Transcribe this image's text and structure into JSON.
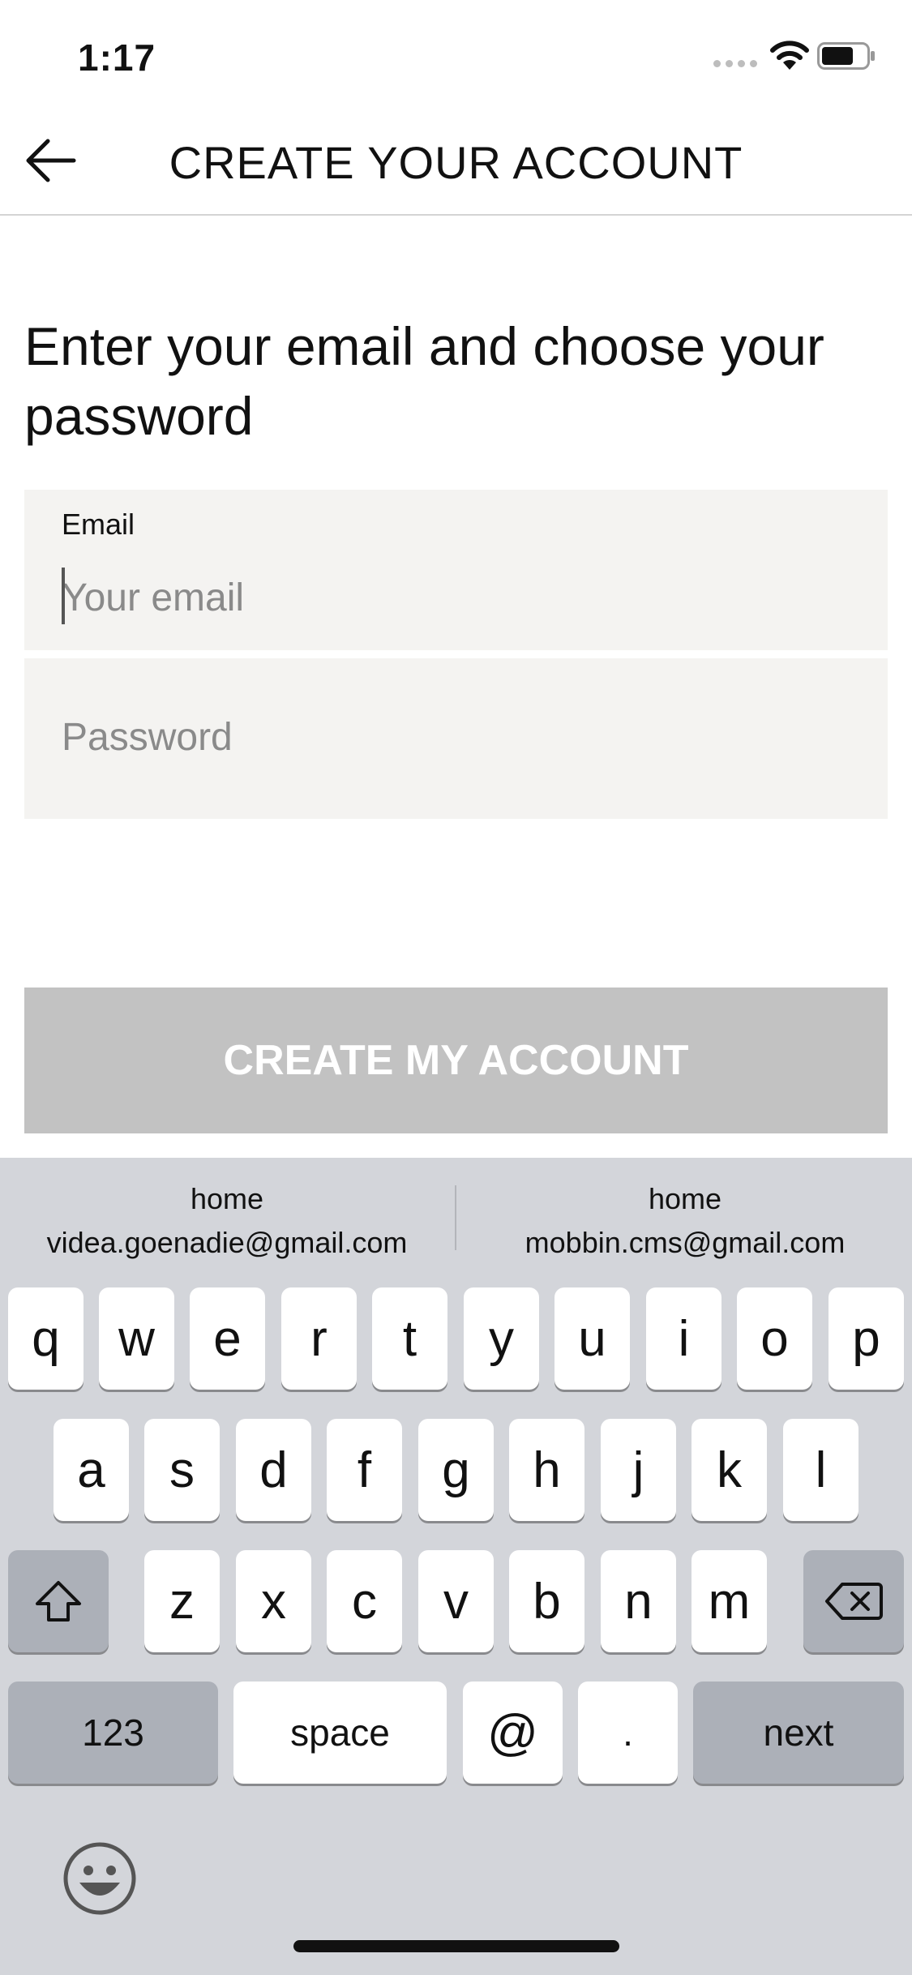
{
  "status_bar": {
    "time": "1:17"
  },
  "header": {
    "title": "CREATE YOUR ACCOUNT",
    "back_icon": "arrow-left-icon"
  },
  "main": {
    "heading": "Enter your email and choose your password",
    "email_field": {
      "label": "Email",
      "placeholder": "Your email",
      "value": ""
    },
    "password_field": {
      "placeholder": "Password",
      "value": ""
    },
    "submit_label": "CREATE MY ACCOUNT",
    "submit_color": "#c2c2c2"
  },
  "keyboard": {
    "suggestions": [
      {
        "label": "home",
        "email": "videa.goenadie@gmail.com"
      },
      {
        "label": "home",
        "email": "mobbin.cms@gmail.com"
      }
    ],
    "row1": [
      "q",
      "w",
      "e",
      "r",
      "t",
      "y",
      "u",
      "i",
      "o",
      "p"
    ],
    "row2": [
      "a",
      "s",
      "d",
      "f",
      "g",
      "h",
      "j",
      "k",
      "l"
    ],
    "row3": [
      "z",
      "x",
      "c",
      "v",
      "b",
      "n",
      "m"
    ],
    "numbers_label": "123",
    "space_label": "space",
    "at_label": "@",
    "dot_label": ".",
    "next_label": "next",
    "background_color": "#d3d5da"
  }
}
